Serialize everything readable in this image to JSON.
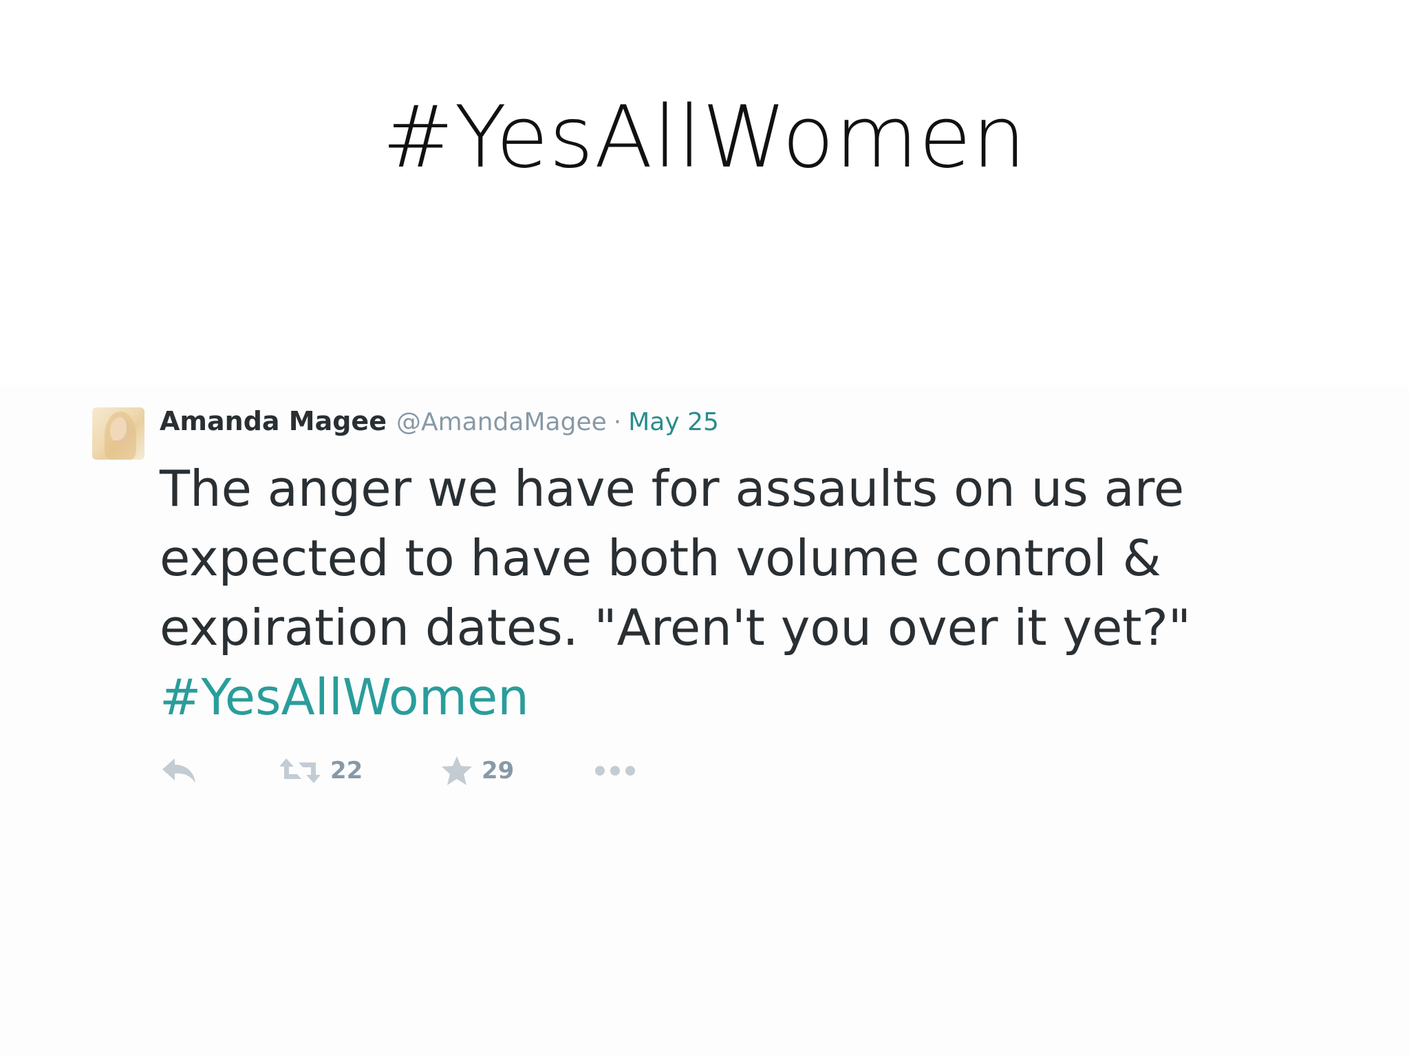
{
  "slide": {
    "title": "#YesAllWomen"
  },
  "tweet": {
    "author_name": "Amanda Magee",
    "author_handle": "@AmandaMagee",
    "separator": "·",
    "date": "May 25",
    "text_lines": [
      "The anger we have for assaults  on us are",
      "expected to have both volume control &",
      "expiration dates. \"Aren't you over it yet?\""
    ],
    "hashtag": "#YesAllWomen",
    "retweet_count": "22",
    "favorite_count": "29",
    "icons": [
      "reply-icon",
      "retweet-icon",
      "star-icon",
      "more-icon"
    ],
    "colors": {
      "text": "#292f33",
      "muted": "#8899a6",
      "link": "#2a9d9b"
    }
  }
}
